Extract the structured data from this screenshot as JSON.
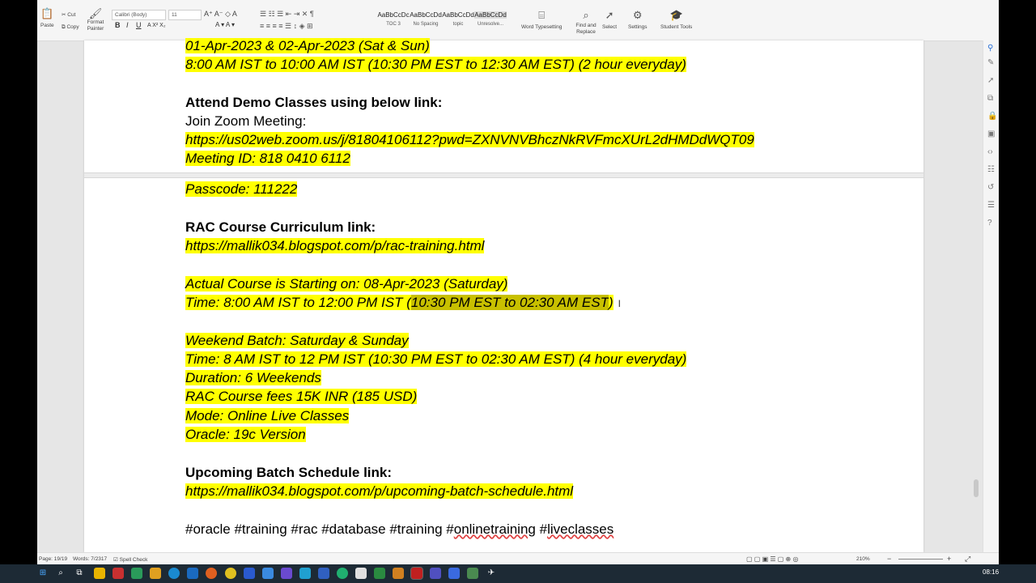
{
  "ribbon": {
    "paste": "Paste",
    "cut": "Cut",
    "copy": "Copy",
    "format_painter": "Format Painter",
    "font_name": "Calibri (Body)",
    "font_size": "11",
    "styles": [
      {
        "preview": "AaBbCcDc",
        "name": "TOC 3"
      },
      {
        "preview": "AaBbCcDd",
        "name": "No Spacing"
      },
      {
        "preview": "AaBbCcDd",
        "name": "topic"
      },
      {
        "preview": "AaBbCcDd",
        "name": "Unresolve..."
      }
    ],
    "word_typesetting": "Word Typesetting",
    "find_replace": "Find and Replace",
    "select": "Select",
    "settings": "Settings",
    "student_tools": "Student Tools"
  },
  "doc": {
    "l1": "01-Apr-2023 & 02-Apr-2023 (Sat & Sun)",
    "l2": "8:00 AM IST to 10:00 AM IST (10:30 PM EST to 12:30 AM EST) (2 hour everyday)",
    "l3": "Attend Demo Classes using below link:",
    "l4": "Join Zoom Meeting:",
    "l5": "https://us02web.zoom.us/j/81804106112?pwd=ZXNVNVBhczNkRVFmcXUrL2dHMDdWQT09",
    "l6": "Meeting ID: 818 0410 6112",
    "l7": "Passcode: 111222",
    "l8": "RAC Course Curriculum link:",
    "l9": "https://mallik034.blogspot.com/p/rac-training.html",
    "l10": "Actual Course is Starting on: 08-Apr-2023 (Saturday)",
    "l11a": "Time: 8:00 AM IST to 12:00 PM IST  (",
    "l11b": "10:30 PM EST to 02:30 AM EST",
    "l11c": ")",
    "l12": "Weekend Batch: Saturday & Sunday",
    "l13": "Time: 8 AM IST to 12 PM IST (10:30 PM EST to 02:30 AM EST) (4 hour everyday)",
    "l14": "Duration: 6 Weekends",
    "l15": "RAC Course fees 15K INR (185 USD)",
    "l16": "Mode: Online Live Classes",
    "l17": "Oracle: 19c Version",
    "l18": "Upcoming Batch Schedule link:",
    "l19": "https://mallik034.blogspot.com/p/upcoming-batch-schedule.html",
    "l20a": "#oracle #training #rac #database #training #",
    "l20b": "onlinetraining",
    "l20c": " #",
    "l20d": "liveclasses"
  },
  "status": {
    "page": "Page: 19/19",
    "words": "Words: 7/2317",
    "spell": "Spell Check",
    "zoom": "210%"
  },
  "taskbar": {
    "time": "08:16"
  },
  "colors": {
    "highlight": "#ffff00",
    "highlight_selected": "#c8c000",
    "taskbar": "#1d2a35"
  }
}
